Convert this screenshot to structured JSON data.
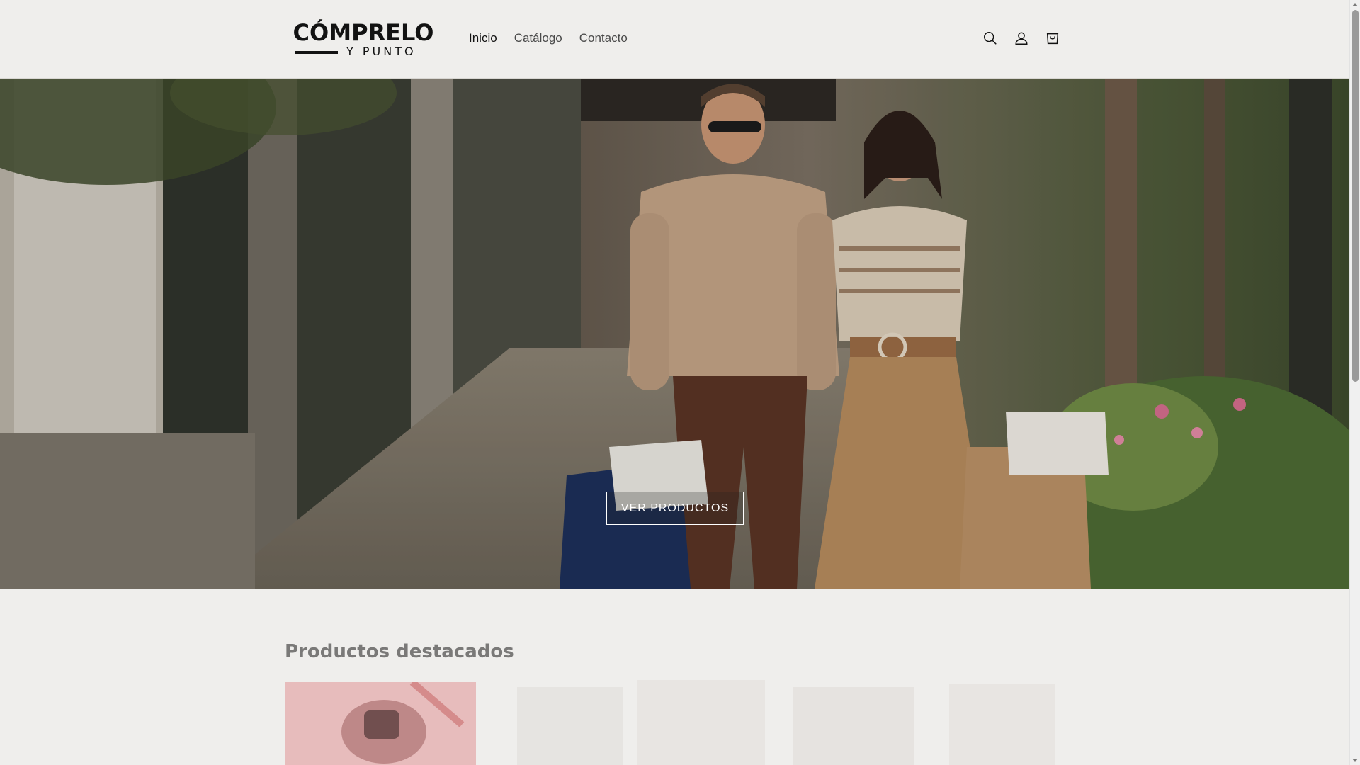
{
  "header": {
    "logo": {
      "top": "CÓMPRELO",
      "bottom": "Y PUNTO"
    },
    "nav": [
      {
        "label": "Inicio",
        "active": true
      },
      {
        "label": "Catálogo",
        "active": false
      },
      {
        "label": "Contacto",
        "active": false
      }
    ],
    "icons": [
      "search-icon",
      "account-icon",
      "cart-icon"
    ]
  },
  "hero": {
    "button_label": "VER PRODUCTOS"
  },
  "featured": {
    "title": "Productos destacados"
  },
  "colors": {
    "background": "#efeeec",
    "text": "#121212",
    "nav_text": "#4a4a4a",
    "section_title": "#7a7978"
  }
}
